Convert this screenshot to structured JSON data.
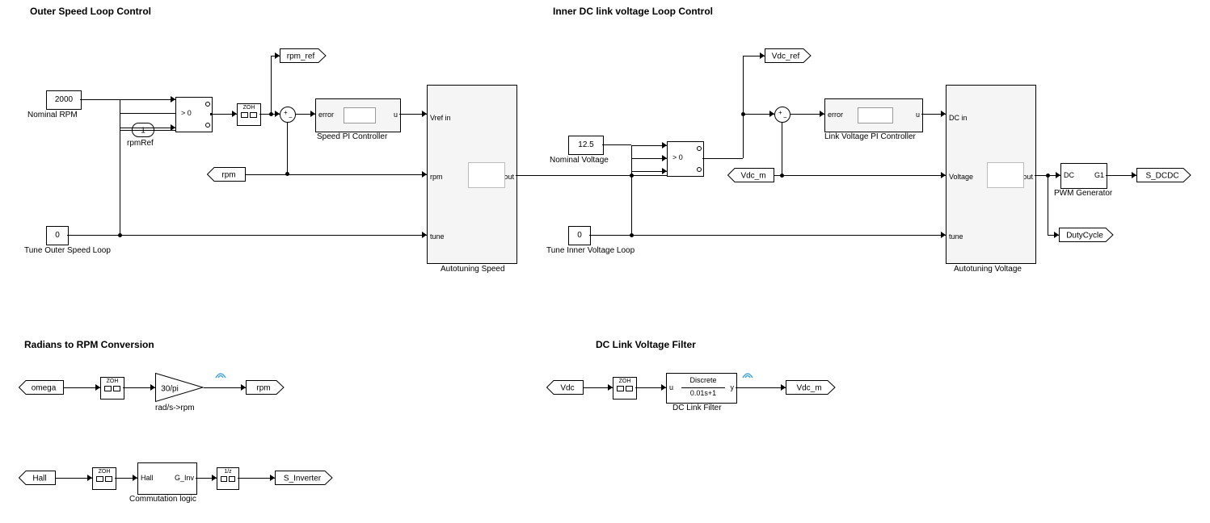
{
  "titles": {
    "outer": "Outer Speed Loop Control",
    "inner": "Inner DC link voltage Loop Control",
    "rad": "Radians to RPM Conversion",
    "filter": "DC Link Voltage Filter"
  },
  "constants": {
    "nominalRPM": "2000",
    "nominalRPM_label": "Nominal RPM",
    "rpmRef_idx": "1",
    "rpmRef_label": "rpmRef",
    "tuneOuter": "0",
    "tuneOuter_label": "Tune Outer Speed Loop",
    "nominalVoltage": "12.5",
    "nominalVoltage_label": "Nominal Voltage",
    "tuneInner": "0",
    "tuneInner_label": "Tune Inner Voltage Loop"
  },
  "blocks": {
    "switch_cond": "> 0",
    "zoh": "ZOH",
    "speedPI": "Speed PI Controller",
    "speedPI_err": "error",
    "speedPI_u": "u",
    "autoSpeed": "Autotuning Speed",
    "autoSpeed_vin": "Vref in",
    "autoSpeed_rpm": "rpm",
    "autoSpeed_tune": "tune",
    "autoSpeed_vout": "Vref out",
    "linkPI": "Link Voltage PI Controller",
    "linkPI_err": "error",
    "linkPI_u": "u",
    "autoV": "Autotuning Voltage",
    "autoV_dcin": "DC in",
    "autoV_voltage": "Voltage",
    "autoV_tune": "tune",
    "autoV_dcout": "DC out",
    "pwm": "PWM Generator",
    "pwm_dc": "DC",
    "pwm_g1": "G1",
    "gain": "30/pi",
    "gain_label": "rad/s->rpm",
    "dcfilter_u": "u",
    "dcfilter_y": "y",
    "dcfilter_num": "Discrete",
    "dcfilter_den": "0.01s+1",
    "dcfilter_label": "DC Link Filter",
    "comm": "Commutation logic",
    "comm_hall": "Hall",
    "comm_g": "G_Inv"
  },
  "tags": {
    "rpm_ref": "rpm_ref",
    "rpm_from": "rpm",
    "rpm_goto": "rpm",
    "vdc_ref": "Vdc_ref",
    "vdc_m_from": "Vdc_m",
    "vdc_m_goto": "Vdc_m",
    "s_dcdc": "S_DCDC",
    "dutycycle": "DutyCycle",
    "omega": "omega",
    "vdc": "Vdc",
    "hall": "Hall",
    "s_inverter": "S_Inverter"
  }
}
